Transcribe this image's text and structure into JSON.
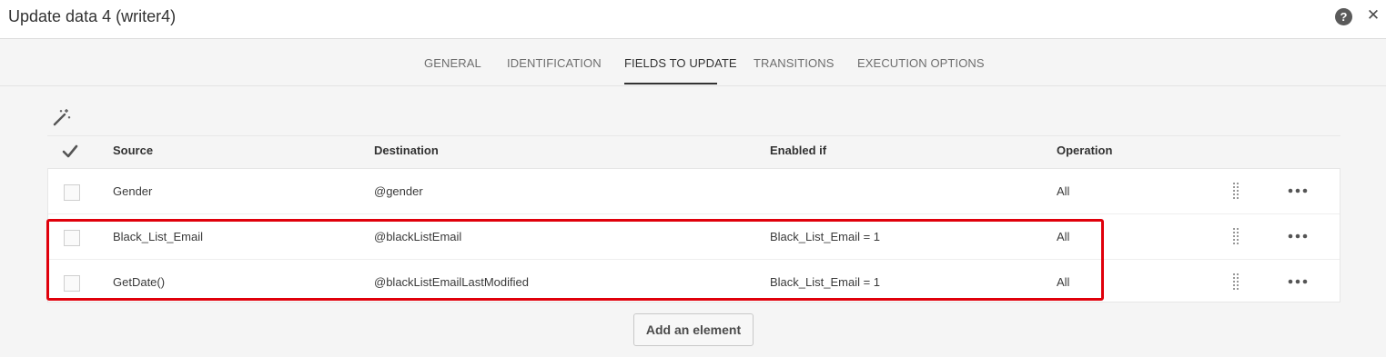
{
  "window": {
    "title": "Update data 4 (writer4)"
  },
  "header_icons": {
    "help": "?",
    "close": "✕"
  },
  "tabs": [
    {
      "label": "GENERAL",
      "active": false
    },
    {
      "label": "IDENTIFICATION",
      "active": false
    },
    {
      "label": "FIELDS TO UPDATE",
      "active": true
    },
    {
      "label": "TRANSITIONS",
      "active": false
    },
    {
      "label": "EXECUTION OPTIONS",
      "active": false
    }
  ],
  "grid": {
    "columns": [
      "Source",
      "Destination",
      "Enabled if",
      "Operation"
    ],
    "rows": [
      {
        "source": "Gender",
        "destination": "@gender",
        "enabled_if": "",
        "operation": "All"
      },
      {
        "source": "Black_List_Email",
        "destination": "@blackListEmail",
        "enabled_if": "Black_List_Email = 1",
        "operation": "All"
      },
      {
        "source": "GetDate()",
        "destination": "@blackListEmailLastModified",
        "enabled_if": "Black_List_Email = 1",
        "operation": "All"
      }
    ]
  },
  "add_button": {
    "label": "Add an element"
  },
  "colors": {
    "highlight": "#e0000b",
    "active_tab": "#323232"
  }
}
